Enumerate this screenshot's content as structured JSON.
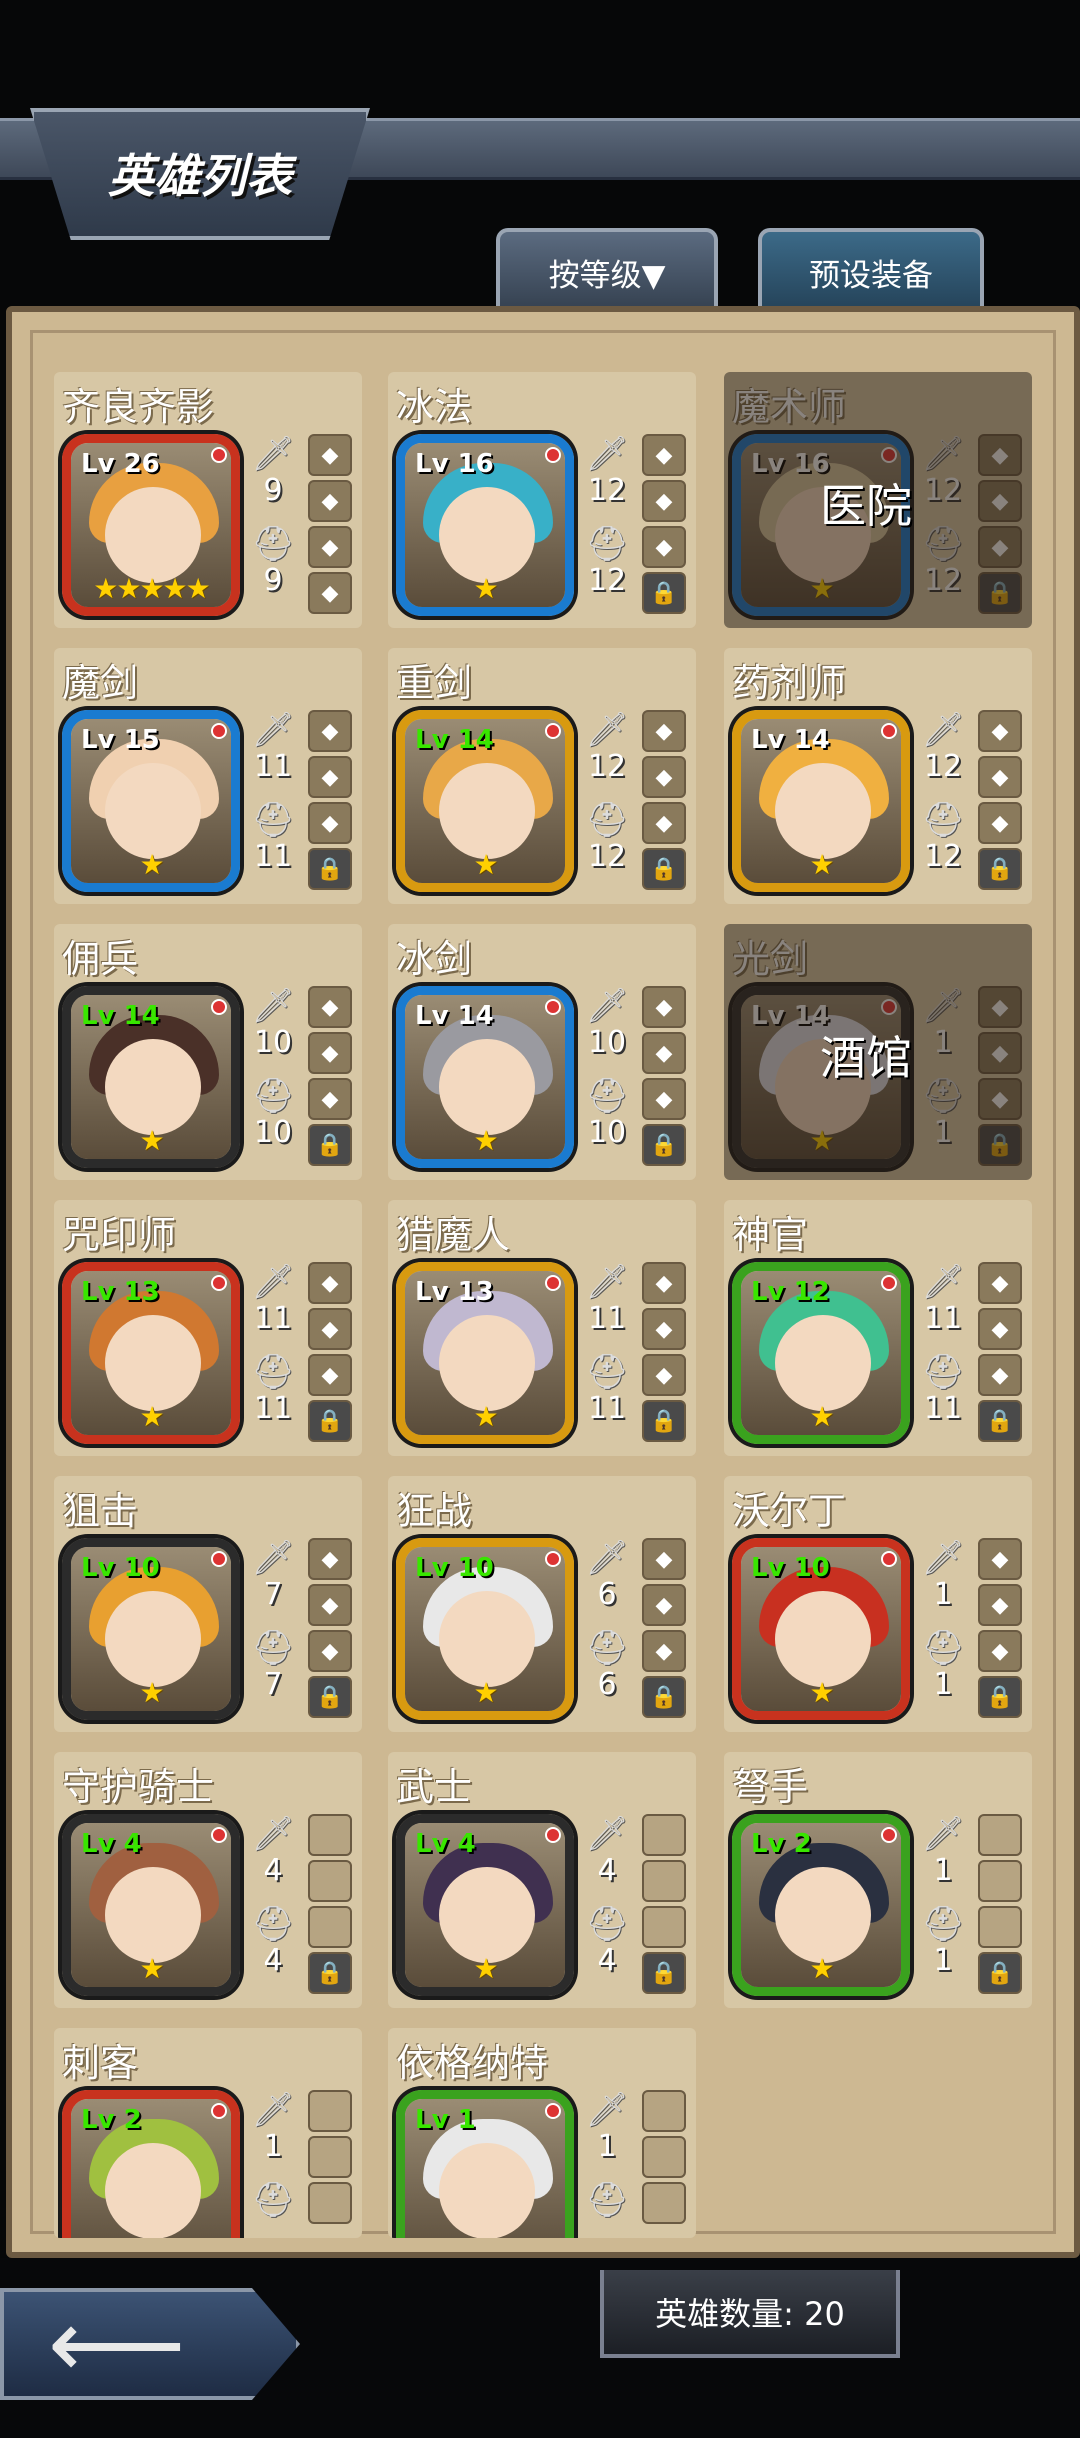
{
  "header": {
    "title": "英雄列表"
  },
  "tabs": {
    "sort": "按等级▼",
    "preset": "预设装备"
  },
  "footer": {
    "count": "英雄数量: 20",
    "back_icon": "left-arrow-icon"
  },
  "overlays": {
    "hospital": "医院",
    "tavern": "酒馆"
  },
  "heroes": [
    {
      "name": "齐良齐影",
      "lv": "Lv 26",
      "atk": "9",
      "def": "9",
      "stars": "★★★★★",
      "frame": "#c8321e",
      "lvColor": "#fff",
      "slots": [
        "item",
        "item",
        "item",
        "item"
      ]
    },
    {
      "name": "冰法",
      "lv": "Lv 16",
      "atk": "12",
      "def": "12",
      "stars": "★",
      "frame": "#1a7bd0",
      "lvColor": "#fff",
      "slots": [
        "item",
        "item",
        "item",
        "lock"
      ]
    },
    {
      "name": "魔术师",
      "lv": "Lv 16",
      "atk": "12",
      "def": "12",
      "stars": "★",
      "frame": "#1a7bd0",
      "lvColor": "#fff",
      "slots": [
        "item",
        "item",
        "item",
        "lock"
      ]
    },
    {
      "name": "魔剑",
      "lv": "Lv 15",
      "atk": "11",
      "def": "11",
      "stars": "★",
      "frame": "#1a7bd0",
      "lvColor": "#fff",
      "slots": [
        "item",
        "item",
        "item",
        "lock"
      ]
    },
    {
      "name": "重剑",
      "lv": "Lv 14",
      "atk": "12",
      "def": "12",
      "stars": "★",
      "frame": "#d89a10",
      "lvColor": "#39e600",
      "slots": [
        "item",
        "item",
        "item",
        "lock"
      ]
    },
    {
      "name": "药剂师",
      "lv": "Lv 14",
      "atk": "12",
      "def": "12",
      "stars": "★",
      "frame": "#d89a10",
      "lvColor": "#fff",
      "slots": [
        "item",
        "item",
        "item",
        "lock"
      ]
    },
    {
      "name": "佣兵",
      "lv": "Lv 14",
      "atk": "10",
      "def": "10",
      "stars": "★",
      "frame": "#2b2b2b",
      "lvColor": "#39e600",
      "slots": [
        "item",
        "item",
        "item",
        "lock"
      ]
    },
    {
      "name": "冰剑",
      "lv": "Lv 14",
      "atk": "10",
      "def": "10",
      "stars": "★",
      "frame": "#1a7bd0",
      "lvColor": "#fff",
      "slots": [
        "item",
        "item",
        "item",
        "lock"
      ]
    },
    {
      "name": "光剑",
      "lv": "Lv 14",
      "atk": "1",
      "def": "1",
      "stars": "★",
      "frame": "#2b2b2b",
      "lvColor": "#fff",
      "slots": [
        "item",
        "item",
        "item",
        "lock"
      ]
    },
    {
      "name": "咒印师",
      "lv": "Lv 13",
      "atk": "11",
      "def": "11",
      "stars": "★",
      "frame": "#c8321e",
      "lvColor": "#39e600",
      "slots": [
        "item",
        "item",
        "item",
        "lock"
      ]
    },
    {
      "name": "猎魔人",
      "lv": "Lv 13",
      "atk": "11",
      "def": "11",
      "stars": "★",
      "frame": "#d89a10",
      "lvColor": "#fff",
      "slots": [
        "item",
        "item",
        "item",
        "lock"
      ]
    },
    {
      "name": "神官",
      "lv": "Lv 12",
      "atk": "11",
      "def": "11",
      "stars": "★",
      "frame": "#3aa21e",
      "lvColor": "#39e600",
      "slots": [
        "item",
        "item",
        "item",
        "lock"
      ]
    },
    {
      "name": "狙击",
      "lv": "Lv 10",
      "atk": "7",
      "def": "7",
      "stars": "★",
      "frame": "#2b2b2b",
      "lvColor": "#39e600",
      "slots": [
        "item",
        "item",
        "item",
        "lock"
      ]
    },
    {
      "name": "狂战",
      "lv": "Lv 10",
      "atk": "6",
      "def": "6",
      "stars": "★",
      "frame": "#d89a10",
      "lvColor": "#39e600",
      "slots": [
        "item",
        "item",
        "item",
        "lock"
      ]
    },
    {
      "name": "沃尔丁",
      "lv": "Lv 10",
      "atk": "1",
      "def": "1",
      "stars": "★",
      "frame": "#c8321e",
      "lvColor": "#39e600",
      "slots": [
        "item",
        "item",
        "item",
        "lock"
      ]
    },
    {
      "name": "守护骑士",
      "lv": "Lv 4",
      "atk": "4",
      "def": "4",
      "stars": "★",
      "frame": "#2b2b2b",
      "lvColor": "#39e600",
      "slots": [
        "empty",
        "empty",
        "empty",
        "lock"
      ]
    },
    {
      "name": "武士",
      "lv": "Lv 4",
      "atk": "4",
      "def": "4",
      "stars": "★",
      "frame": "#2b2b2b",
      "lvColor": "#39e600",
      "slots": [
        "empty",
        "empty",
        "empty",
        "lock"
      ]
    },
    {
      "name": "弩手",
      "lv": "Lv 2",
      "atk": "1",
      "def": "1",
      "stars": "★",
      "frame": "#3aa21e",
      "lvColor": "#39e600",
      "slots": [
        "empty",
        "empty",
        "empty",
        "lock"
      ]
    },
    {
      "name": "刺客",
      "lv": "Lv 2",
      "atk": "1",
      "def": "",
      "stars": "",
      "frame": "#c8321e",
      "lvColor": "#39e600",
      "slots": [
        "empty",
        "empty",
        "empty"
      ]
    },
    {
      "name": "依格纳特",
      "lv": "Lv 1",
      "atk": "1",
      "def": "",
      "stars": "",
      "frame": "#3aa21e",
      "lvColor": "#39e600",
      "slots": [
        "empty",
        "empty",
        "empty"
      ]
    }
  ]
}
